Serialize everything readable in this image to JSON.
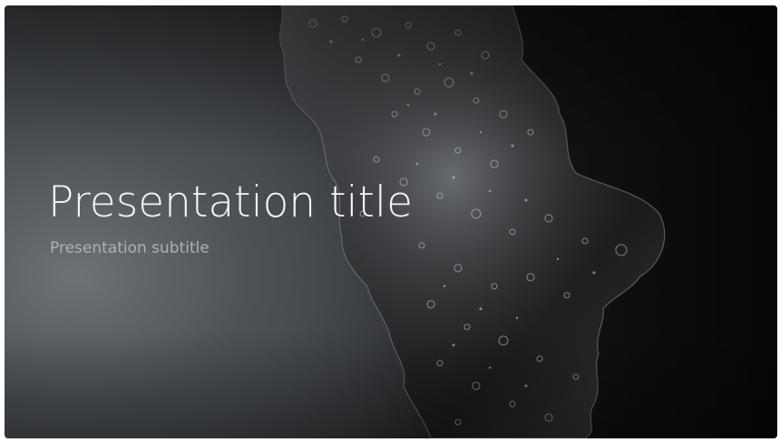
{
  "slide": {
    "title": "Presentation title",
    "subtitle": "Presentation subtitle"
  },
  "colors": {
    "title": "#f4f5f6",
    "subtitle": "#aeb2b6",
    "background_dark": "#060607",
    "background_light": "#6e7276"
  },
  "background_image": "dark liquid splash with bubbles"
}
